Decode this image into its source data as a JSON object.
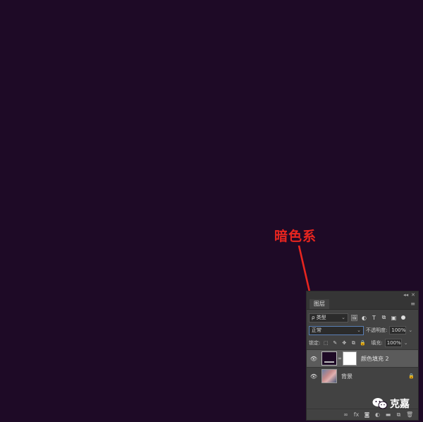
{
  "annotation": {
    "text": "暗色系",
    "color": "#e8251f"
  },
  "canvas": {
    "background": "#1e0a26"
  },
  "panel": {
    "collapse_glyph": "◂◂",
    "close_glyph": "✕",
    "tab_label": "图层",
    "menu_glyph": "≡",
    "filter": {
      "value": "类型",
      "search_glyph": "ρ",
      "chevron": "⌄"
    },
    "filter_icons": [
      "🖼",
      "◐",
      "T",
      "⧉",
      "▣"
    ],
    "blend": {
      "value": "正常",
      "chevron": "⌄"
    },
    "opacity": {
      "label": "不透明度:",
      "value": "100%"
    },
    "lock": {
      "label": "锁定:",
      "icons": [
        "⬚",
        "✎",
        "✥",
        "⧉",
        "🔒"
      ]
    },
    "fill": {
      "label": "填充:",
      "value": "100%"
    },
    "layers": [
      {
        "name": "颜色填充 2",
        "selected": true,
        "type": "fill"
      },
      {
        "name": "背景",
        "selected": false,
        "type": "photo",
        "locked": true
      }
    ],
    "eye_glyph": "👁",
    "chain_glyph": "∞",
    "lock_glyph": "🔒",
    "bottom_icons": [
      "∞",
      "fx",
      "◙",
      "◐",
      "▬",
      "⧉",
      "🗑"
    ]
  },
  "watermark": {
    "text": "克嘉"
  }
}
